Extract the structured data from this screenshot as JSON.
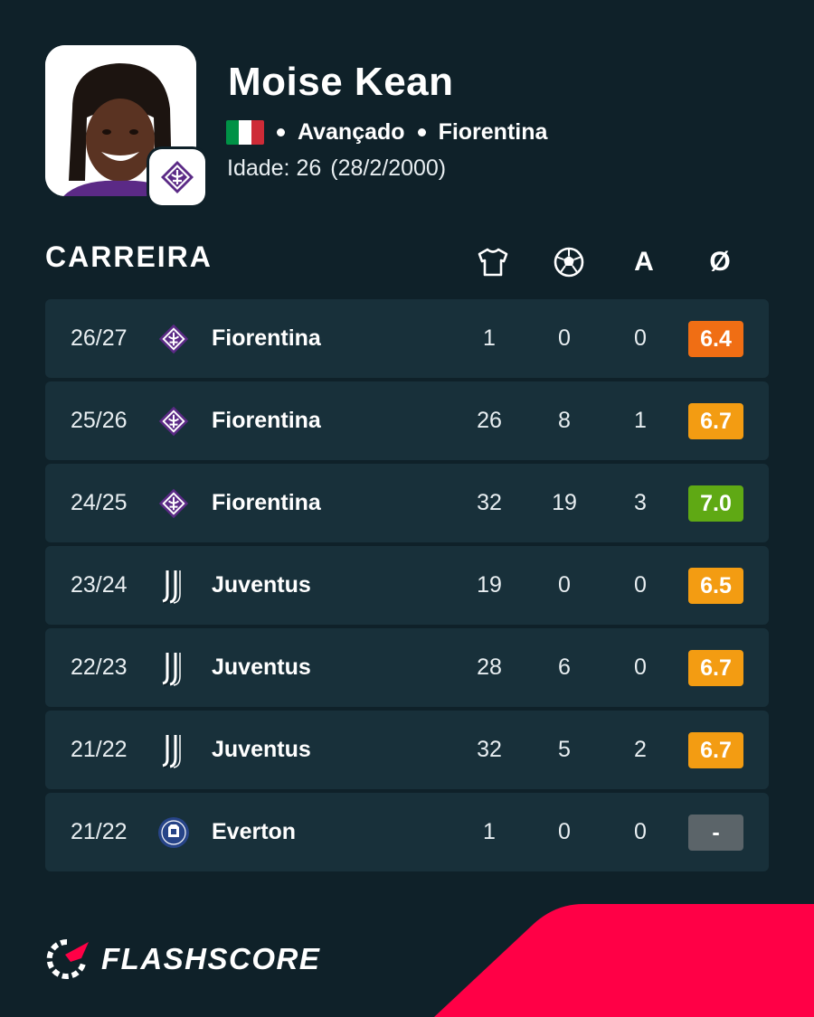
{
  "player": {
    "name": "Moise Kean",
    "nationality_flag_colors": [
      "#009246",
      "#ffffff",
      "#ce2b37"
    ],
    "position": "Avançado",
    "club": "Fiorentina",
    "age_text": "Idade: 26",
    "birthdate": "(28/2/2000)"
  },
  "career": {
    "title": "CARREIRA",
    "columns": [
      {
        "icon": "jersey-icon"
      },
      {
        "icon": "ball-icon"
      },
      {
        "label": "A"
      },
      {
        "label": "Ø"
      }
    ],
    "rows": [
      {
        "season": "26/27",
        "team": "Fiorentina",
        "logo": "fiorentina-logo-icon",
        "apps": "1",
        "goals": "0",
        "assists": "0",
        "rating": "6.4",
        "rating_color": "#f06e14"
      },
      {
        "season": "25/26",
        "team": "Fiorentina",
        "logo": "fiorentina-logo-icon",
        "apps": "26",
        "goals": "8",
        "assists": "1",
        "rating": "6.7",
        "rating_color": "#f39c12"
      },
      {
        "season": "24/25",
        "team": "Fiorentina",
        "logo": "fiorentina-logo-icon",
        "apps": "32",
        "goals": "19",
        "assists": "3",
        "rating": "7.0",
        "rating_color": "#5fa914"
      },
      {
        "season": "23/24",
        "team": "Juventus",
        "logo": "juventus-logo-icon",
        "apps": "19",
        "goals": "0",
        "assists": "0",
        "rating": "6.5",
        "rating_color": "#f39c12"
      },
      {
        "season": "22/23",
        "team": "Juventus",
        "logo": "juventus-logo-icon",
        "apps": "28",
        "goals": "6",
        "assists": "0",
        "rating": "6.7",
        "rating_color": "#f39c12"
      },
      {
        "season": "21/22",
        "team": "Juventus",
        "logo": "juventus-logo-icon",
        "apps": "32",
        "goals": "5",
        "assists": "2",
        "rating": "6.7",
        "rating_color": "#f39c12"
      },
      {
        "season": "21/22",
        "team": "Everton",
        "logo": "everton-logo-icon",
        "apps": "1",
        "goals": "0",
        "assists": "0",
        "rating": "-",
        "rating_color": "#5b6469"
      }
    ]
  },
  "brand": {
    "name": "FLASHSCORE",
    "accent_color": "#ff0046"
  }
}
